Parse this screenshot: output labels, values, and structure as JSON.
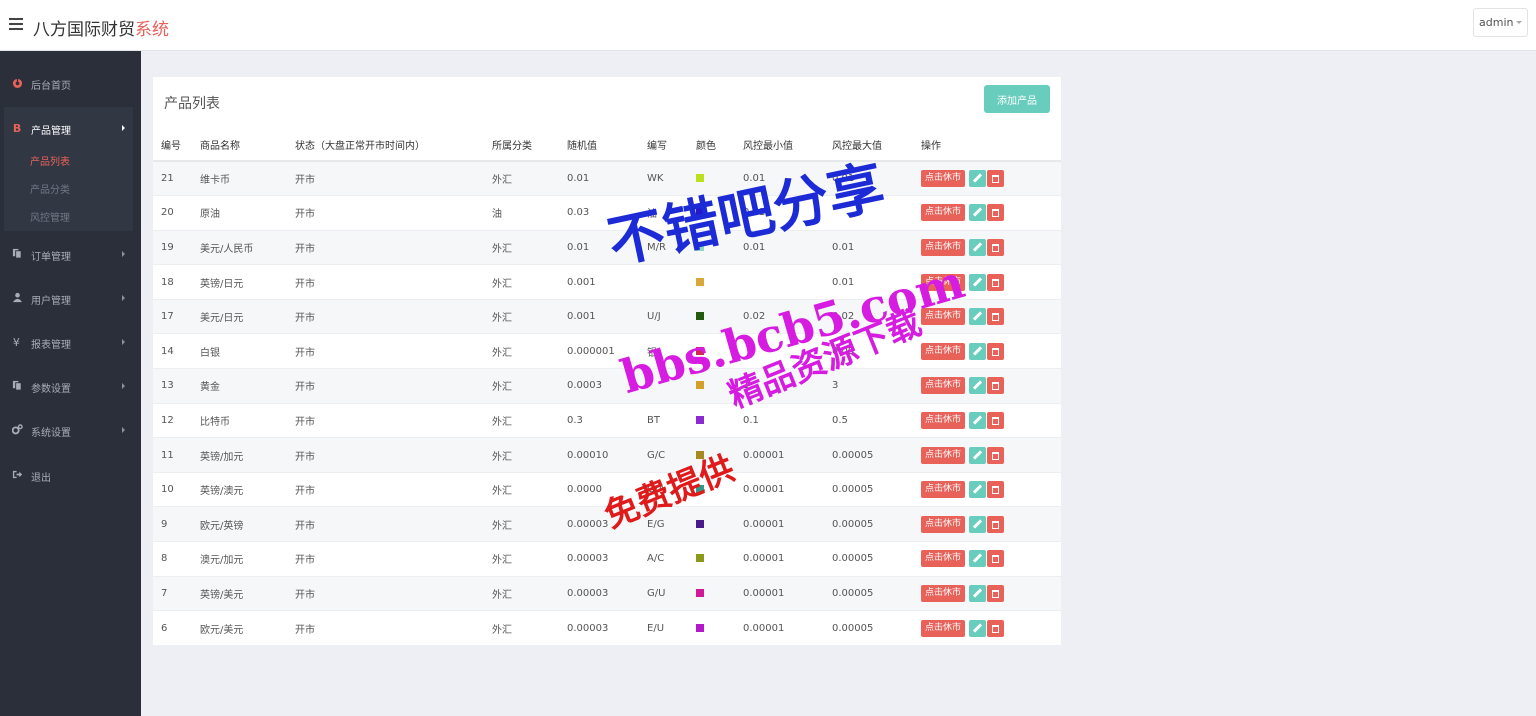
{
  "header": {
    "brand_main": "八方国际财贸",
    "brand_accent": "系统",
    "user": "admin"
  },
  "sidebar": {
    "items": [
      {
        "label": "后台首页",
        "icon": "dashboard-icon"
      },
      {
        "label": "产品管理",
        "icon": "bitcoin-icon"
      },
      {
        "label": "订单管理",
        "icon": "copy-icon"
      },
      {
        "label": "用户管理",
        "icon": "user-icon"
      },
      {
        "label": "报表管理",
        "icon": "yen-icon"
      },
      {
        "label": "参数设置",
        "icon": "copy-icon"
      },
      {
        "label": "系统设置",
        "icon": "gears-icon"
      },
      {
        "label": "退出",
        "icon": "sign-out-icon"
      }
    ],
    "sub_items": [
      {
        "label": "产品列表",
        "active": true
      },
      {
        "label": "产品分类",
        "active": false
      },
      {
        "label": "风控管理",
        "active": false
      }
    ]
  },
  "card": {
    "title": "产品列表",
    "add_button": "添加产品"
  },
  "table": {
    "headers": [
      "编号",
      "商品名称",
      "状态（大盘正常开市时间内）",
      "所属分类",
      "随机值",
      "编写",
      "颜色",
      "风控最小值",
      "风控最大值",
      "操作"
    ],
    "rest_label": "点击休市",
    "rows": [
      {
        "id": "21",
        "name": "维卡币",
        "status": "开市",
        "category": "外汇",
        "random": "0.01",
        "code": "WK",
        "color": "#bbe01e",
        "min": "0.01",
        "max": "0.01"
      },
      {
        "id": "20",
        "name": "原油",
        "status": "开市",
        "category": "油",
        "random": "0.03",
        "code": "油",
        "color": "#2418c8",
        "min": "0.01",
        "max": ""
      },
      {
        "id": "19",
        "name": "美元/人民币",
        "status": "开市",
        "category": "外汇",
        "random": "0.01",
        "code": "M/R",
        "color": "#8ed7c0",
        "min": "0.01",
        "max": "0.01"
      },
      {
        "id": "18",
        "name": "英镑/日元",
        "status": "开市",
        "category": "外汇",
        "random": "0.001",
        "code": "",
        "color": "#d8a93a",
        "min": "",
        "max": "0.01"
      },
      {
        "id": "17",
        "name": "美元/日元",
        "status": "开市",
        "category": "外汇",
        "random": "0.001",
        "code": "U/J",
        "color": "#245a10",
        "min": "0.02",
        "max": "0.02"
      },
      {
        "id": "14",
        "name": "白银",
        "status": "开市",
        "category": "外汇",
        "random": "0.000001",
        "code": "银",
        "color": "#d02a50",
        "min": "",
        "max": "0.09"
      },
      {
        "id": "13",
        "name": "黄金",
        "status": "开市",
        "category": "外汇",
        "random": "0.0003",
        "code": "",
        "color": "#d4a02c",
        "min": "1",
        "max": "3"
      },
      {
        "id": "12",
        "name": "比特币",
        "status": "开市",
        "category": "外汇",
        "random": "0.3",
        "code": "BT",
        "color": "#8a2ad0",
        "min": "0.1",
        "max": "0.5"
      },
      {
        "id": "11",
        "name": "英镑/加元",
        "status": "开市",
        "category": "外汇",
        "random": "0.00010",
        "code": "G/C",
        "color": "#a48a20",
        "min": "0.00001",
        "max": "0.00005"
      },
      {
        "id": "10",
        "name": "英镑/澳元",
        "status": "开市",
        "category": "外汇",
        "random": "0.0000",
        "code": "G/A",
        "color": "#2e9a8c",
        "min": "0.00001",
        "max": "0.00005"
      },
      {
        "id": "9",
        "name": "欧元/英镑",
        "status": "开市",
        "category": "外汇",
        "random": "0.00003",
        "code": "E/G",
        "color": "#4a1a8c",
        "min": "0.00001",
        "max": "0.00005"
      },
      {
        "id": "8",
        "name": "澳元/加元",
        "status": "开市",
        "category": "外汇",
        "random": "0.00003",
        "code": "A/C",
        "color": "#8a9a18",
        "min": "0.00001",
        "max": "0.00005"
      },
      {
        "id": "7",
        "name": "英镑/美元",
        "status": "开市",
        "category": "外汇",
        "random": "0.00003",
        "code": "G/U",
        "color": "#d0189a",
        "min": "0.00001",
        "max": "0.00005"
      },
      {
        "id": "6",
        "name": "欧元/美元",
        "status": "开市",
        "category": "外汇",
        "random": "0.00003",
        "code": "E/U",
        "color": "#b418c8",
        "min": "0.00001",
        "max": "0.00005"
      }
    ]
  },
  "watermark": {
    "line1": "不错吧分享",
    "line2": "bbs.bcb5.com",
    "line3": "精品资源下载",
    "line4": "免费提供",
    "color1": "#1d2bd6",
    "color2": "#d61ce0",
    "color3": "#e01a1a"
  }
}
